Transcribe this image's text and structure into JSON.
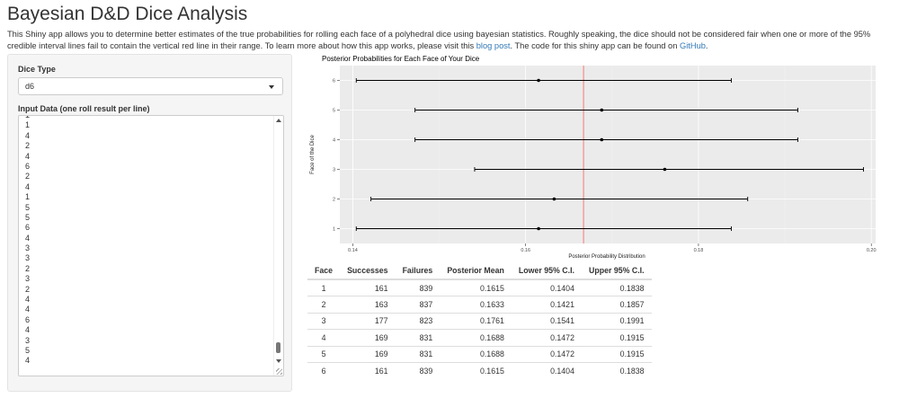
{
  "title": "Bayesian D&D Dice Analysis",
  "description": {
    "part1": "This Shiny app allows you to determine better estimates of the true probabilities for rolling each face of a polyhedral dice using bayesian statistics. Roughly speaking, the dice should not be considered fair when one or more of the 95% credible interval lines fail to contain the vertical red line in their range. To learn more about how this app works, please visit this ",
    "link1": "blog post",
    "part2": ". The code for this shiny app can be found on ",
    "link2": "GitHub",
    "part3": "."
  },
  "sidebar": {
    "dice_type_label": "Dice Type",
    "dice_type_value": "d6",
    "input_label": "Input Data (one roll result per line)",
    "input_lines": [
      "1",
      "1",
      "4",
      "2",
      "4",
      "6",
      "2",
      "4",
      "1",
      "5",
      "5",
      "6",
      "4",
      "3",
      "3",
      "2",
      "3",
      "2",
      "4",
      "4",
      "6",
      "4",
      "3",
      "5",
      "4"
    ]
  },
  "chart_data": {
    "type": "scatter",
    "title": "Posterior Probabilities for Each Face of Your Dice",
    "xlabel": "Posterior Probability Distribution",
    "ylabel": "Face of the Dice",
    "xlim": [
      0.1385,
      0.2005
    ],
    "x_ticks": [
      "0.14",
      "0.16",
      "0.18",
      "0.20"
    ],
    "y_ticks": [
      "1",
      "2",
      "3",
      "4",
      "5",
      "6"
    ],
    "reference_line": 0.1667,
    "reference_color": "#ff5a5a",
    "grid": true,
    "faces": [
      1,
      2,
      3,
      4,
      5,
      6
    ],
    "mean": [
      0.1615,
      0.1633,
      0.1761,
      0.1688,
      0.1688,
      0.1615
    ],
    "lower": [
      0.1404,
      0.1421,
      0.1541,
      0.1472,
      0.1472,
      0.1404
    ],
    "upper": [
      0.1838,
      0.1857,
      0.1991,
      0.1915,
      0.1915,
      0.1838
    ]
  },
  "table": {
    "headers": [
      "Face",
      "Successes",
      "Failures",
      "Posterior Mean",
      "Lower 95% C.I.",
      "Upper 95% C.I."
    ],
    "rows": [
      [
        "1",
        "161",
        "839",
        "0.1615",
        "0.1404",
        "0.1838"
      ],
      [
        "2",
        "163",
        "837",
        "0.1633",
        "0.1421",
        "0.1857"
      ],
      [
        "3",
        "177",
        "823",
        "0.1761",
        "0.1541",
        "0.1991"
      ],
      [
        "4",
        "169",
        "831",
        "0.1688",
        "0.1472",
        "0.1915"
      ],
      [
        "5",
        "169",
        "831",
        "0.1688",
        "0.1472",
        "0.1915"
      ],
      [
        "6",
        "161",
        "839",
        "0.1615",
        "0.1404",
        "0.1838"
      ]
    ]
  }
}
